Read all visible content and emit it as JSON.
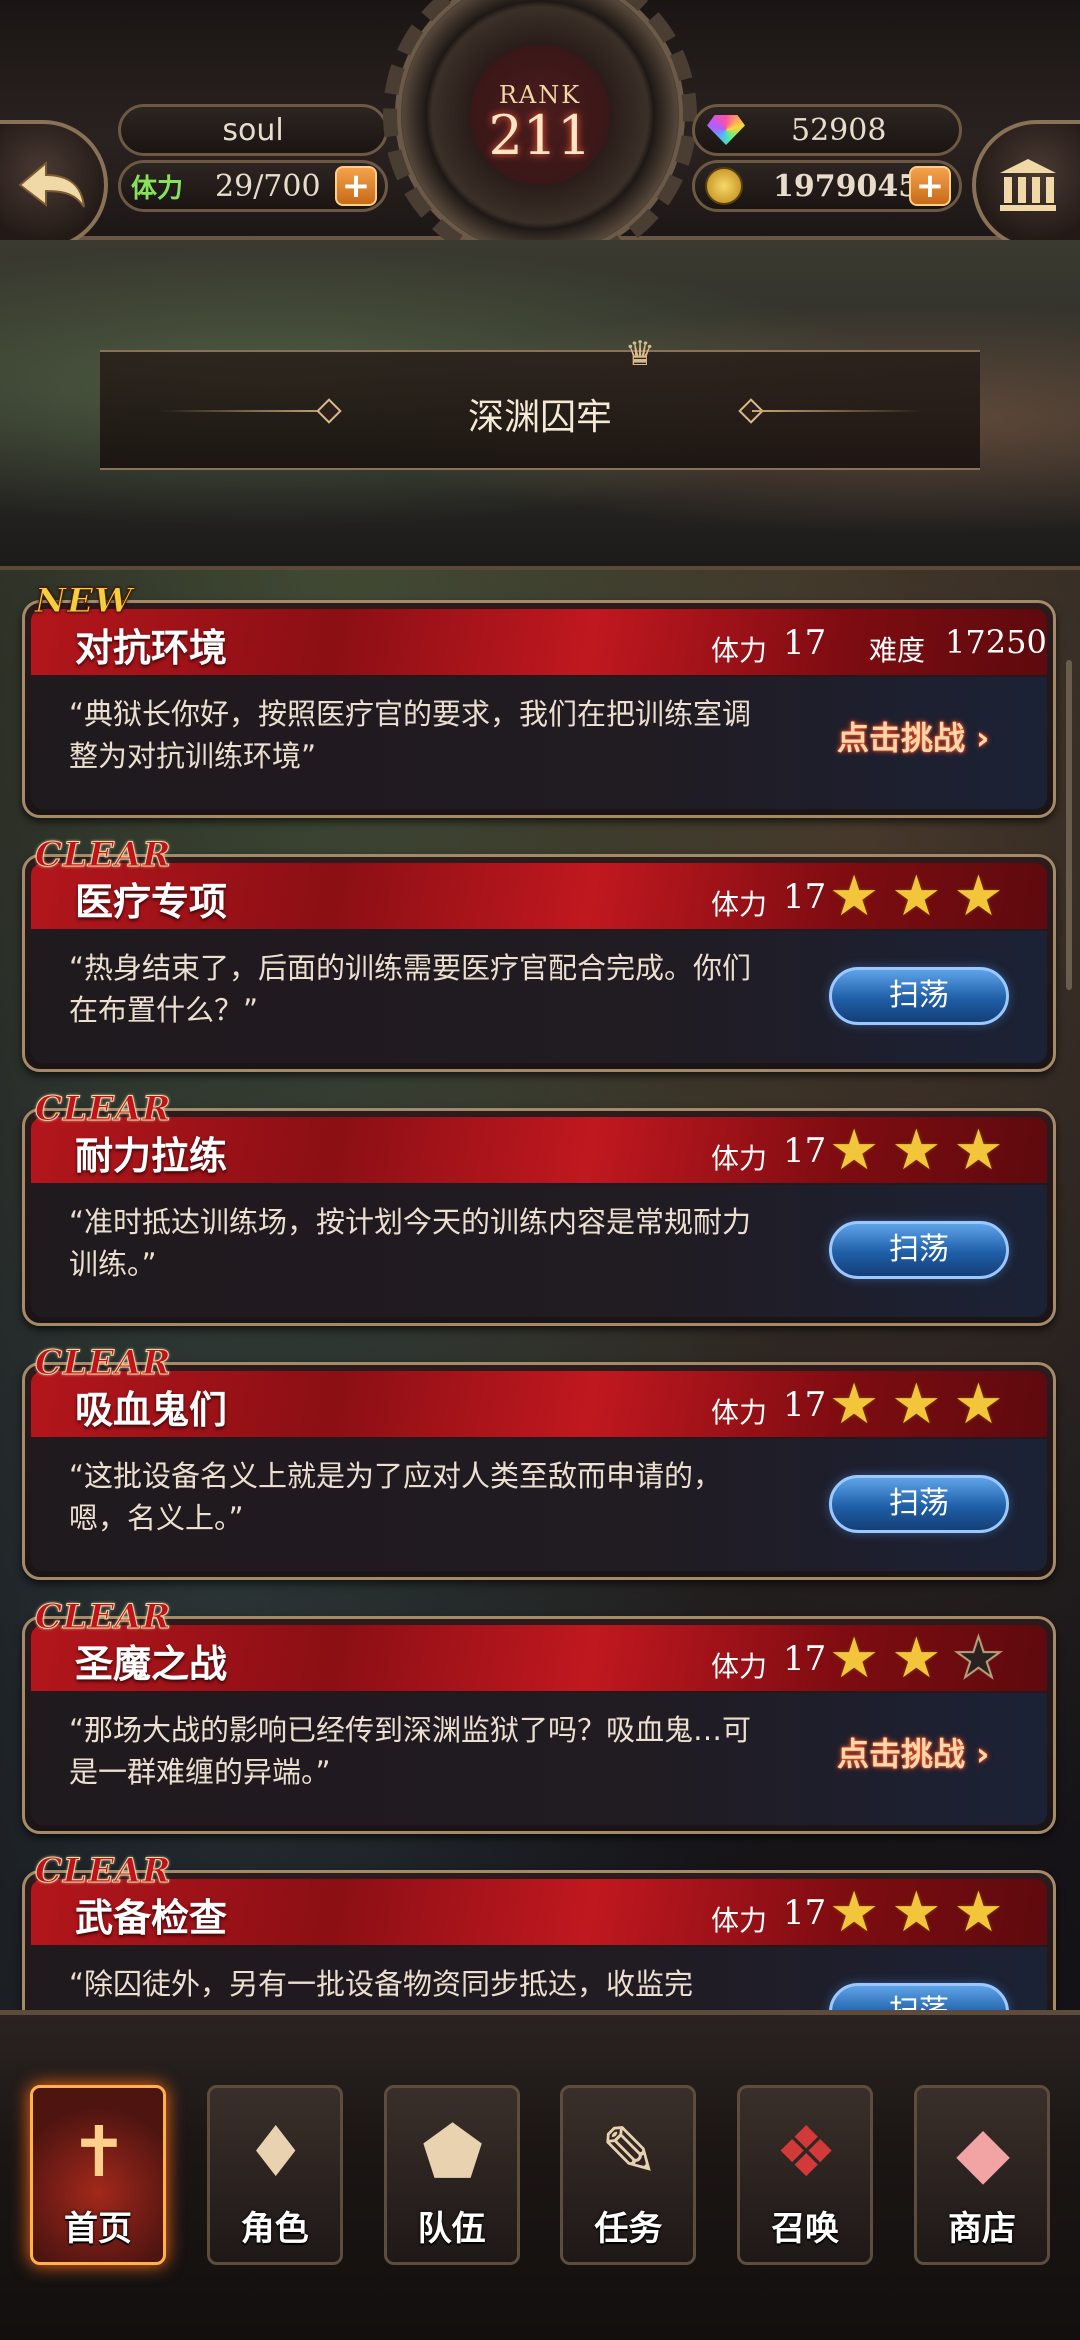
{
  "header": {
    "player_name": "soul",
    "stamina_label": "体力",
    "stamina_value": "29/700",
    "rank_label": "RANK",
    "rank_value": "211",
    "gems": "52908",
    "coins": "1979045",
    "plus_symbol": "+",
    "back_icon": "back-arrow-icon",
    "bank_icon": "bank-icon"
  },
  "stage": {
    "title": "深渊囚牢"
  },
  "cards": [
    {
      "badge": "NEW",
      "name": "对抗环境",
      "stamina_label": "体力",
      "stamina": "17",
      "difficulty_label": "难度",
      "difficulty": "17250",
      "desc": "“典狱长你好，按照医疗官的要求，我们在把训练室调整为对抗训练环境”",
      "action": "点击挑战 ›"
    },
    {
      "badge": "CLEAR",
      "name": "医疗专项",
      "stamina_label": "体力",
      "stamina": "17",
      "stars": 3,
      "desc": "“热身结束了，后面的训练需要医疗官配合完成。你们在布置什么？”",
      "action": "扫荡"
    },
    {
      "badge": "CLEAR",
      "name": "耐力拉练",
      "stamina_label": "体力",
      "stamina": "17",
      "stars": 3,
      "desc": "“准时抵达训练场，按计划今天的训练内容是常规耐力训练。”",
      "action": "扫荡"
    },
    {
      "badge": "CLEAR",
      "name": "吸血鬼们",
      "stamina_label": "体力",
      "stamina": "17",
      "stars": 3,
      "desc": "“这批设备名义上就是为了应对人类至敌而申请的，嗯，名义上。”",
      "action": "扫荡"
    },
    {
      "badge": "CLEAR",
      "name": "圣魔之战",
      "stamina_label": "体力",
      "stamina": "17",
      "stars": 2,
      "desc": "“那场大战的影响已经传到深渊监狱了吗？吸血鬼…可是一群难缠的异端。”",
      "action": "点击挑战 ›"
    },
    {
      "badge": "CLEAR",
      "name": "武备检查",
      "stamina_label": "体力",
      "stamina": "17",
      "stars": 3,
      "desc": "“除囚徒外，另有一批设备物资同步抵达，收监完",
      "action": "扫荡"
    }
  ],
  "nav": [
    {
      "label": "首页",
      "icon": "home-banner-icon",
      "active": true
    },
    {
      "label": "角色",
      "icon": "character-card-icon",
      "active": false
    },
    {
      "label": "队伍",
      "icon": "team-pentagon-icon",
      "active": false
    },
    {
      "label": "任务",
      "icon": "quest-book-icon",
      "active": false
    },
    {
      "label": "召唤",
      "icon": "summon-card-icon",
      "active": false
    },
    {
      "label": "商店",
      "icon": "shop-gem-icon",
      "active": false
    }
  ],
  "colors": {
    "card_header_red": "#b3161c",
    "star_gold": "#f3c53a",
    "sweep_blue": "#1f5fa8",
    "challenge_glow": "#ff4a2a"
  }
}
